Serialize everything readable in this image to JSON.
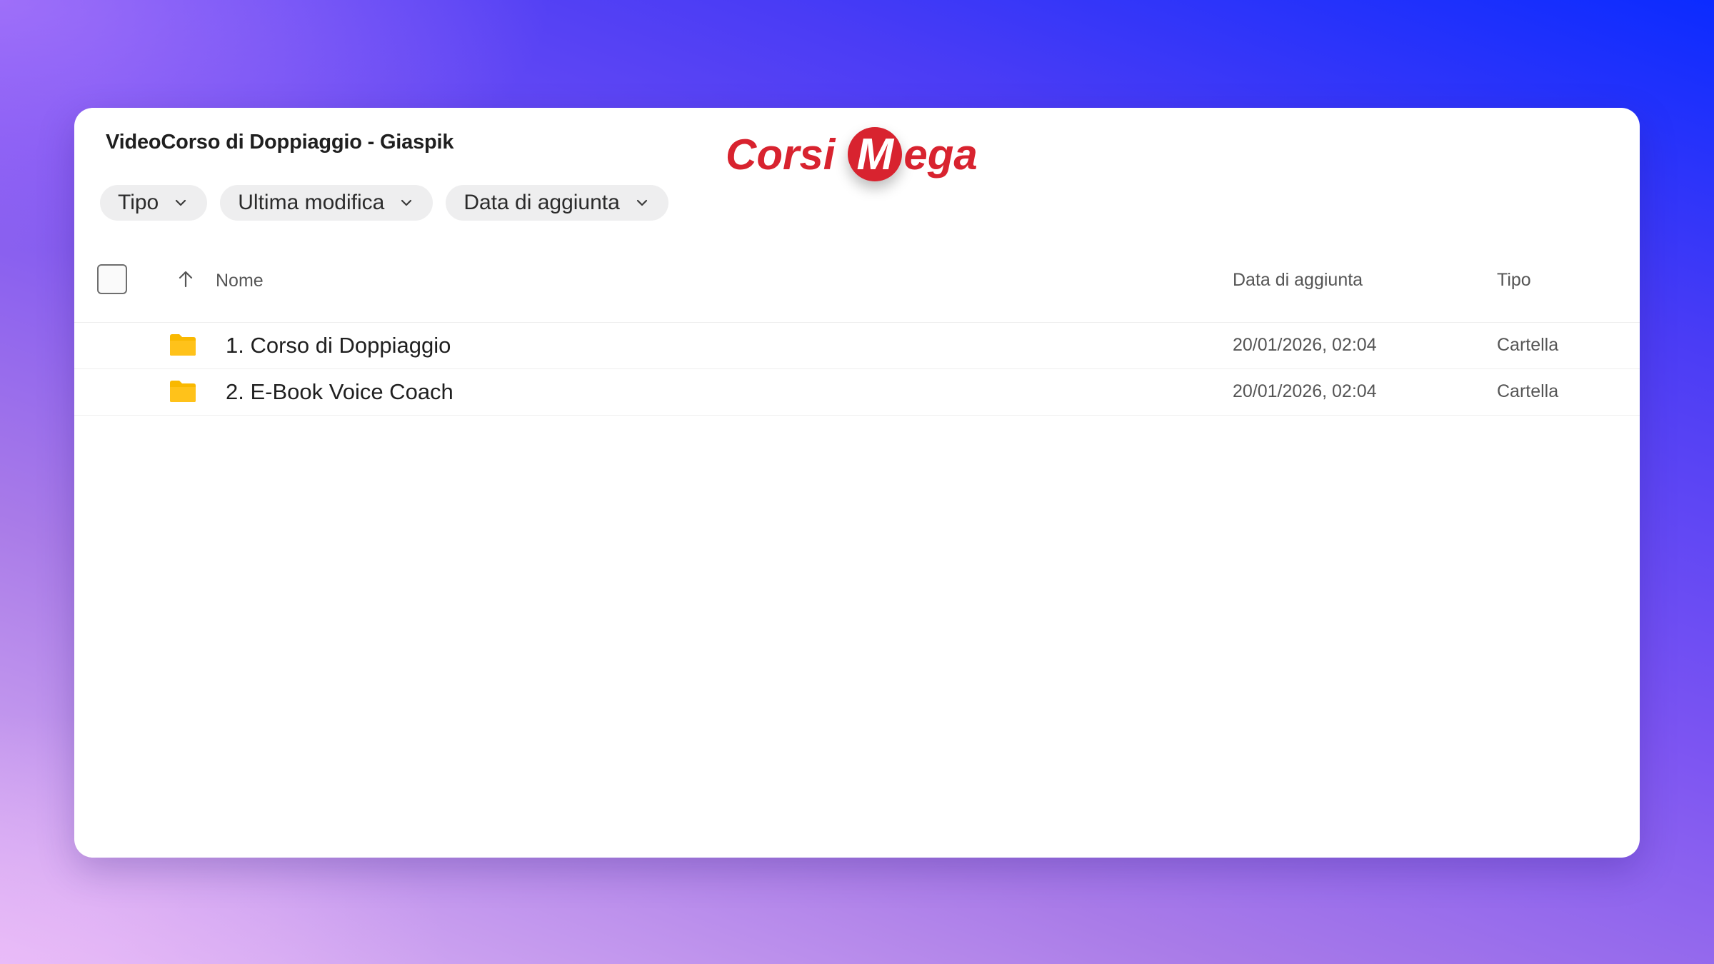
{
  "folder_title": "VideoCorso di Doppiaggio - Giaspik",
  "logo": {
    "part1": "Corsi",
    "m": "M",
    "part2": "ega"
  },
  "filters": [
    {
      "label": "Tipo",
      "icon": "chevron-down-icon"
    },
    {
      "label": "Ultima modifica",
      "icon": "chevron-down-icon"
    },
    {
      "label": "Data di aggiunta",
      "icon": "chevron-down-icon"
    }
  ],
  "columns": {
    "name": "Nome",
    "date_added": "Data di aggiunta",
    "type": "Tipo"
  },
  "rows": [
    {
      "name": "1. Corso di Doppiaggio",
      "date_added": "20/01/2026, 02:04",
      "type": "Cartella",
      "icon": "folder-icon"
    },
    {
      "name": "2. E-Book Voice Coach",
      "date_added": "20/01/2026, 02:04",
      "type": "Cartella",
      "icon": "folder-icon"
    }
  ],
  "colors": {
    "folder": "#f9b800",
    "logo_red": "#d8232f",
    "panel": "#ffffff"
  }
}
